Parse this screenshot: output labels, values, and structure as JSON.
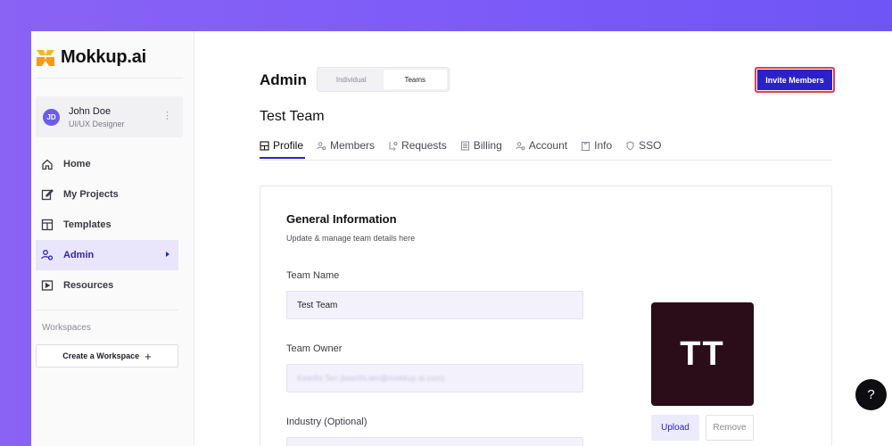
{
  "app": {
    "name": "Mokkup.ai"
  },
  "user": {
    "initials": "JD",
    "name": "John Doe",
    "role": "UI/UX Designer"
  },
  "sidebar": {
    "items": [
      {
        "label": "Home",
        "icon": "home-icon",
        "active": false
      },
      {
        "label": "My Projects",
        "icon": "edit-icon",
        "active": false
      },
      {
        "label": "Templates",
        "icon": "template-icon",
        "active": false
      },
      {
        "label": "Admin",
        "icon": "users-admin-icon",
        "active": true
      },
      {
        "label": "Resources",
        "icon": "play-square-icon",
        "active": false
      }
    ],
    "workspaces_label": "Workspaces",
    "create_workspace_label": "Create a Workspace",
    "create_workspace_symbol": "+"
  },
  "header": {
    "title": "Admin",
    "segments": [
      "Individual",
      "Teams"
    ],
    "selected_segment": "Teams",
    "invite_label": "Invite Members"
  },
  "team": {
    "title": "Test Team"
  },
  "tabs": [
    {
      "label": "Profile",
      "icon": "layout-icon",
      "active": true
    },
    {
      "label": "Members",
      "icon": "members-icon",
      "active": false
    },
    {
      "label": "Requests",
      "icon": "user-request-icon",
      "active": false
    },
    {
      "label": "Billing",
      "icon": "receipt-icon",
      "active": false
    },
    {
      "label": "Account",
      "icon": "account-icon",
      "active": false
    },
    {
      "label": "Info",
      "icon": "clipboard-icon",
      "active": false
    },
    {
      "label": "SSO",
      "icon": "shield-icon",
      "active": false
    }
  ],
  "general_info": {
    "title": "General Information",
    "subtitle": "Update & manage team details here",
    "team_name_label": "Team Name",
    "team_name_value": "Test Team",
    "team_owner_label": "Team Owner",
    "team_owner_value": "Keerthi Teri (keerthi.teri@mokkup.ai.com)",
    "industry_label": "Industry (Optional)"
  },
  "team_avatar": {
    "initials": "TT",
    "upload_label": "Upload",
    "remove_label": "Remove"
  },
  "help": {
    "symbol": "?"
  },
  "colors": {
    "accent": "#2b21c9",
    "active_bg": "#e9e6fb",
    "avatar_bg": "#2a0d19",
    "background": "#7a5af8"
  }
}
